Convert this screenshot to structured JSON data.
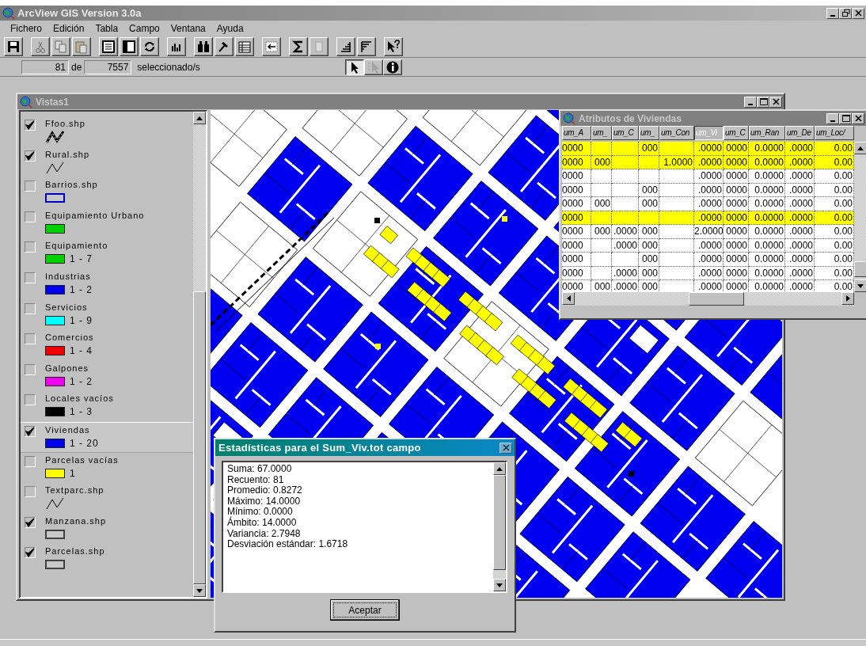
{
  "app": {
    "title": "ArcView GIS Version 3.0a"
  },
  "menu": [
    "Fichero",
    "Edición",
    "Tabla",
    "Campo",
    "Ventana",
    "Ayuda"
  ],
  "toolbar": [
    [
      {
        "disabled": false
      }
    ],
    [
      {
        "disabled": true
      },
      {
        "disabled": true
      },
      {
        "disabled": true
      }
    ],
    [
      {
        "disabled": false
      },
      {
        "disabled": false
      },
      {
        "disabled": false
      }
    ],
    [
      {
        "disabled": false
      }
    ],
    [
      {
        "disabled": false
      },
      {
        "disabled": false
      },
      {
        "disabled": false
      }
    ],
    [
      {
        "disabled": false
      }
    ],
    [
      {
        "disabled": false
      },
      {
        "disabled": true
      }
    ],
    [
      {
        "disabled": false
      },
      {
        "disabled": false
      }
    ],
    [
      {
        "disabled": false
      }
    ]
  ],
  "selection": {
    "count": "81",
    "of": "de",
    "total": "7557",
    "label": "seleccionado/s"
  },
  "tools": [
    {
      "selected": true,
      "disabled": false
    },
    {
      "selected": false,
      "disabled": true
    },
    {
      "selected": false,
      "disabled": false
    }
  ],
  "view": {
    "title": "Vistas1",
    "legend": [
      {
        "name": "Ffoo.shp",
        "checked": true,
        "selected": false,
        "kind": "line-thick"
      },
      {
        "name": "Rural.shp",
        "checked": true,
        "selected": false,
        "kind": "line"
      },
      {
        "name": "Barrios.shp",
        "checked": false,
        "selected": false,
        "kind": "outline",
        "color": "#0000c0"
      },
      {
        "name": "Equipamiento Urbano",
        "checked": false,
        "selected": false,
        "kind": "fill",
        "color": "#00d000"
      },
      {
        "name": "Equipamiento",
        "checked": false,
        "selected": false,
        "kind": "fill",
        "color": "#00d000",
        "range": "1 - 7"
      },
      {
        "name": "Industrias",
        "checked": false,
        "selected": false,
        "kind": "fill",
        "color": "#0000f0",
        "range": "1 - 2"
      },
      {
        "name": "Servicios",
        "checked": false,
        "selected": false,
        "kind": "fill",
        "color": "#00ffff",
        "range": "1 - 9"
      },
      {
        "name": "Comercios",
        "checked": false,
        "selected": false,
        "kind": "fill",
        "color": "#f00000",
        "range": "1 - 4"
      },
      {
        "name": "Galpones",
        "checked": false,
        "selected": false,
        "kind": "fill",
        "color": "#f000f0",
        "range": "1 - 2"
      },
      {
        "name": "Locales vacíos",
        "checked": false,
        "selected": false,
        "kind": "fill",
        "color": "#000000",
        "range": "1 - 3"
      },
      {
        "name": "Viviendas",
        "checked": true,
        "selected": true,
        "kind": "fill",
        "color": "#0000f0",
        "range": "1 - 20"
      },
      {
        "name": "Parcelas vacías",
        "checked": false,
        "selected": false,
        "kind": "fill",
        "color": "#ffff00",
        "range": "1"
      },
      {
        "name": "Textparc.shp",
        "checked": false,
        "selected": false,
        "kind": "line"
      },
      {
        "name": "Manzana.shp",
        "checked": true,
        "selected": false,
        "kind": "outline",
        "color": "#404040"
      },
      {
        "name": "Parcelas.shp",
        "checked": true,
        "selected": false,
        "kind": "outline",
        "color": "#404040"
      }
    ]
  },
  "table": {
    "title": "Atributos de Viviendas",
    "columns": [
      {
        "label": "um_A",
        "selected": false
      },
      {
        "label": "um_",
        "selected": false
      },
      {
        "label": "um_C",
        "selected": false
      },
      {
        "label": "um_",
        "selected": false
      },
      {
        "label": "um_Con",
        "selected": false
      },
      {
        "label": "um_Vi",
        "selected": true
      },
      {
        "label": "um_C",
        "selected": false
      },
      {
        "label": "um_Ran",
        "selected": false
      },
      {
        "label": "um_De",
        "selected": false
      },
      {
        "label": "um_Loc/",
        "selected": false
      }
    ],
    "rows": [
      {
        "selected": true,
        "cells": [
          "0000",
          "",
          "",
          "000",
          "",
          ".0000",
          "0000",
          "0.0000",
          ".0000",
          "0.00"
        ]
      },
      {
        "selected": true,
        "cells": [
          "0000",
          "000",
          "",
          "",
          "1.0000",
          ".0000",
          "0000",
          "0.0000",
          ".0000",
          "0.00"
        ]
      },
      {
        "selected": false,
        "cells": [
          "0000",
          "",
          "",
          "",
          "",
          ".0000",
          "0000",
          "0.0000",
          ".0000",
          "0.00"
        ]
      },
      {
        "selected": false,
        "cells": [
          "0000",
          "",
          "",
          "000",
          "",
          ".0000",
          "0000",
          "0.0000",
          ".0000",
          "0.00"
        ]
      },
      {
        "selected": false,
        "cells": [
          "0000",
          "000",
          "",
          "000",
          "",
          ".0000",
          "0000",
          "0.0000",
          ".0000",
          "0.00"
        ]
      },
      {
        "selected": true,
        "cells": [
          "0000",
          "",
          "",
          "",
          "",
          ".0000",
          "0000",
          "0.0000",
          ".0000",
          "0.00"
        ]
      },
      {
        "selected": false,
        "cells": [
          "0000",
          "000",
          ".0000",
          "000",
          "",
          "2.0000",
          "0000",
          "0.0000",
          ".0000",
          "0.00"
        ]
      },
      {
        "selected": false,
        "cells": [
          "0000",
          "",
          ".0000",
          "000",
          "",
          ".0000",
          "0000",
          "0.0000",
          ".0000",
          "0.00"
        ]
      },
      {
        "selected": false,
        "cells": [
          "0000",
          "",
          "",
          "000",
          "",
          ".0000",
          "0000",
          "0.0000",
          ".0000",
          "0.00"
        ]
      },
      {
        "selected": false,
        "cells": [
          "0000",
          "",
          ".0000",
          "000",
          "",
          ".0000",
          "0000",
          "0.0000",
          ".0000",
          "0.00"
        ]
      },
      {
        "selected": false,
        "cells": [
          "0000",
          "000",
          ".0000",
          "000",
          "",
          ".0000",
          "0000",
          "0.0000",
          ".0000",
          "0.00"
        ]
      }
    ]
  },
  "stats": {
    "title": "Estadísticas para el Sum_Viv.tot campo",
    "lines": [
      "Suma: 67.0000",
      "Recuento: 81",
      "Promedio: 0.8272",
      "Máximo: 14.0000",
      "Mínimo: 0.0000",
      "Ámbito: 14.0000",
      "Variancia: 2.7948",
      "Desviación estándar: 1.6718"
    ],
    "button": "Aceptar"
  }
}
